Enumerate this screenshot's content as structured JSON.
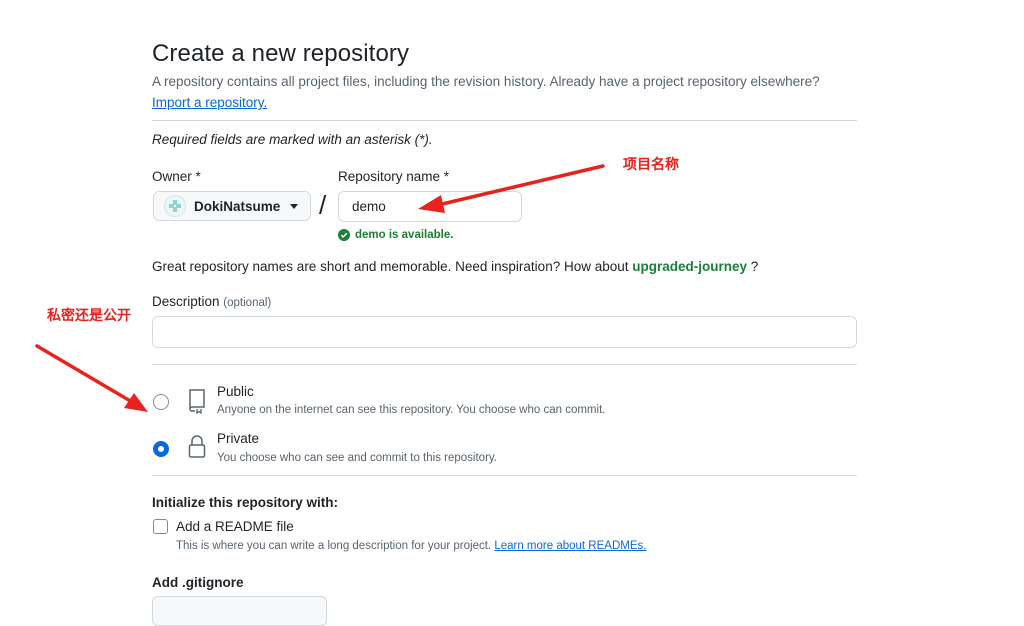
{
  "page": {
    "title": "Create a new repository",
    "subtitle": "A repository contains all project files, including the revision history. Already have a project repository elsewhere?",
    "import_link": "Import a repository.",
    "required_note": "Required fields are marked with an asterisk (*)."
  },
  "owner": {
    "label": "Owner *",
    "selected": "DokiNatsume"
  },
  "repository": {
    "label": "Repository name *",
    "value": "demo",
    "available": "demo is available."
  },
  "inspiration": {
    "text": "Great repository names are short and memorable. Need inspiration? How about",
    "suggestion": "upgraded-journey",
    "suffix": "?"
  },
  "description": {
    "label": "Description",
    "optional": "(optional)",
    "value": ""
  },
  "visibility": {
    "options": [
      {
        "title": "Public",
        "desc": "Anyone on the internet can see this repository. You choose who can commit.",
        "selected": false,
        "icon": "repo-icon"
      },
      {
        "title": "Private",
        "desc": "You choose who can see and commit to this repository.",
        "selected": true,
        "icon": "lock-icon"
      }
    ]
  },
  "initialize": {
    "title": "Initialize this repository with:",
    "readme_label": "Add a README file",
    "readme_checked": false,
    "readme_desc": "This is where you can write a long description for your project.",
    "readme_link": "Learn more about READMEs."
  },
  "gitignore": {
    "label": "Add .gitignore"
  },
  "annotations": {
    "project_name": "项目名称",
    "private_or_public": "私密还是公开"
  },
  "colors": {
    "link": "#0969da",
    "success": "#1a7f37",
    "accent_radio": "#0969da",
    "annotation": "#e8221c"
  }
}
